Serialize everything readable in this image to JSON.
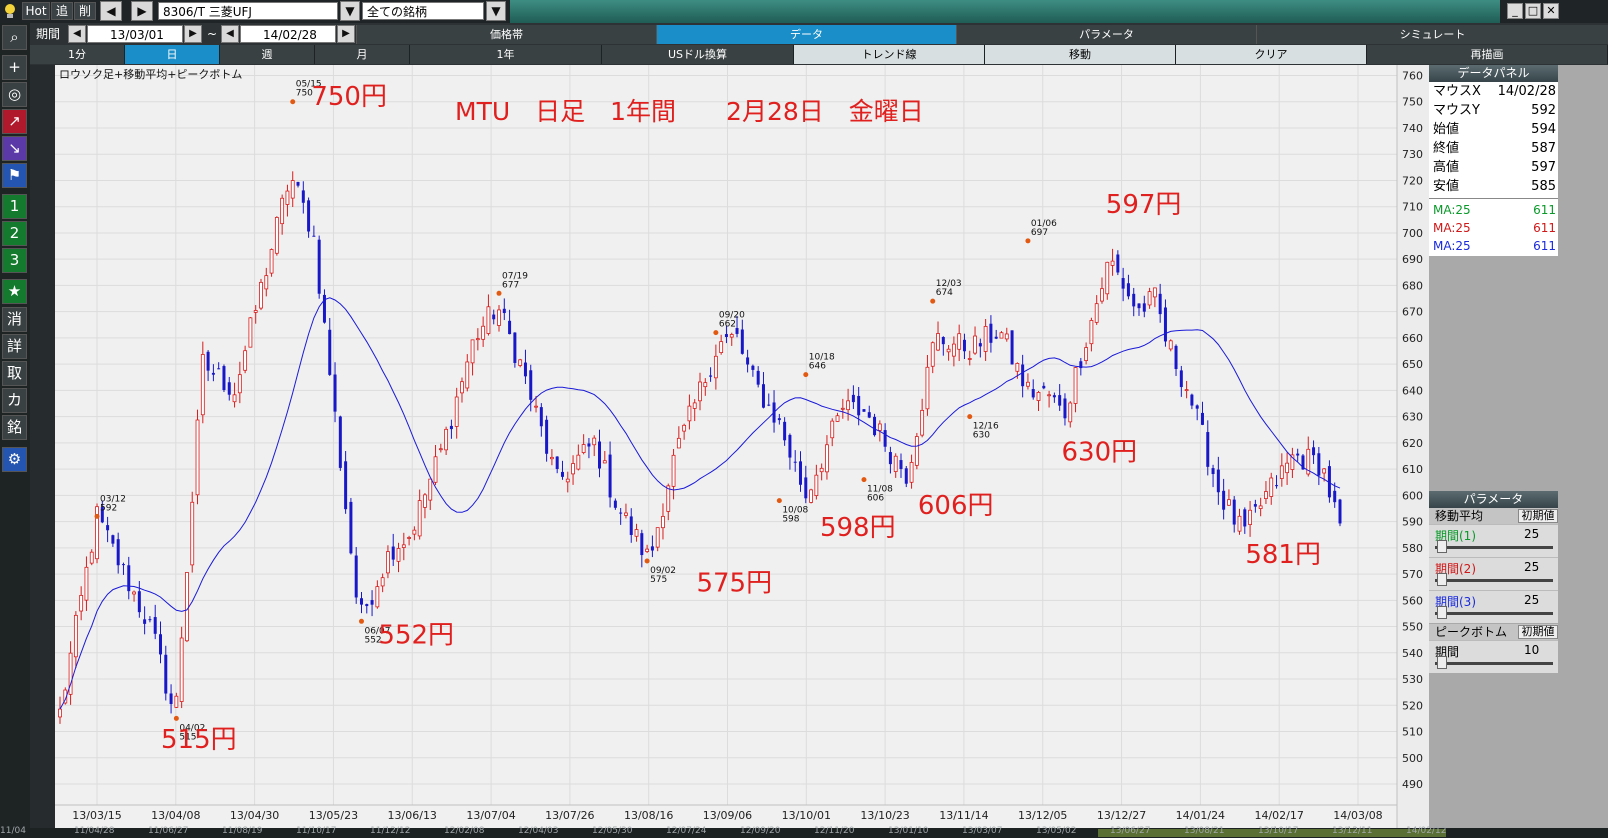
{
  "topbar": {
    "hot": "Hot",
    "tsui": "追",
    "saku": "削",
    "prev_arrow": "◀",
    "next_arrow": "▶",
    "symbol": "8306/T 三菱UFJ",
    "dropdown_arrow": "▼",
    "category": "全ての銘柄",
    "min_btn": "_",
    "max_btn": "□",
    "close_btn": "✕"
  },
  "period_row": {
    "label": "期間",
    "start": "13/03/01",
    "tilde": "~",
    "end": "14/02/28",
    "tabs": [
      "価格帯",
      "データ",
      "パラメータ",
      "シミュレート"
    ]
  },
  "interval_row": {
    "tabs": [
      "1分",
      "日",
      "週",
      "月",
      "1年",
      "USドル換算",
      "トレンド線",
      "移動",
      "クリア",
      "再描画"
    ]
  },
  "sidebar": {
    "buttons": [
      "⌕",
      "+",
      "◎",
      "↗",
      "↘",
      "⚑",
      "1",
      "2",
      "3",
      "★",
      "消",
      "詳",
      "取",
      "カ",
      "銘",
      "⚙"
    ]
  },
  "data_panel": {
    "title": "データパネル",
    "rows": [
      {
        "k": "マウスX",
        "v": "14/02/28"
      },
      {
        "k": "マウスY",
        "v": "592"
      },
      {
        "k": "始値",
        "v": "594"
      },
      {
        "k": "終値",
        "v": "587"
      },
      {
        "k": "高値",
        "v": "597"
      },
      {
        "k": "安値",
        "v": "585"
      }
    ],
    "ma_rows": [
      {
        "k": "MA:25",
        "v": "611",
        "color": "#0a9a2a"
      },
      {
        "k": "MA:25",
        "v": "611",
        "color": "#d01818"
      },
      {
        "k": "MA:25",
        "v": "611",
        "color": "#1a2adc"
      }
    ]
  },
  "param_panel": {
    "title": "パラメータ",
    "ma_header": "移動平均",
    "reset": "初期値",
    "periods": [
      {
        "label": "期間(1)",
        "value": "25",
        "color": "#0a9a2a"
      },
      {
        "label": "期間(2)",
        "value": "25",
        "color": "#d01818"
      },
      {
        "label": "期間(3)",
        "value": "25",
        "color": "#1a2adc"
      }
    ],
    "peak_header": "ピークボトム",
    "peak_reset": "初期値",
    "peak_label": "期間",
    "peak_value": "10"
  },
  "chart_data": {
    "type": "candlestick",
    "legend": "ロウソク足+移動平均+ピークボトム",
    "title": "MTU　日足　1年間　　2月28日　金曜日",
    "ylim": [
      482,
      764
    ],
    "yticks": [
      490,
      500,
      510,
      520,
      530,
      540,
      550,
      560,
      570,
      580,
      590,
      600,
      610,
      620,
      630,
      640,
      650,
      660,
      670,
      680,
      690,
      700,
      710,
      720,
      730,
      740,
      750,
      760
    ],
    "xticks": [
      "13/03/15",
      "13/04/08",
      "13/04/30",
      "13/05/23",
      "13/06/13",
      "13/07/04",
      "13/07/26",
      "13/08/16",
      "13/09/06",
      "13/10/01",
      "13/10/23",
      "13/11/14",
      "13/12/05",
      "13/12/27",
      "14/01/24",
      "14/02/17",
      "14/03/08"
    ],
    "bottom_scroll_dates": [
      "11/04",
      "11/04/28",
      "11/06/27",
      "11/08/19",
      "11/10/17",
      "11/12/12",
      "12/02/08",
      "12/04/03",
      "12/05/30",
      "12/07/24",
      "12/09/20",
      "12/11/20",
      "13/01/10",
      "13/03/07",
      "13/05/02",
      "13/06/27",
      "13/08/21",
      "13/10/17",
      "13/12/11",
      "14/02/12"
    ],
    "ma_period": 25,
    "ma_color": "#1a1ad8",
    "up_color": "#d81c1c",
    "down_color": "#1818c8",
    "days": 243,
    "anchors": [
      [
        0,
        517
      ],
      [
        8,
        592
      ],
      [
        20,
        548
      ],
      [
        25,
        515
      ],
      [
        31,
        650
      ],
      [
        38,
        640
      ],
      [
        50,
        722
      ],
      [
        55,
        700
      ],
      [
        65,
        552
      ],
      [
        72,
        580
      ],
      [
        76,
        585
      ],
      [
        83,
        618
      ],
      [
        90,
        660
      ],
      [
        95,
        672
      ],
      [
        100,
        650
      ],
      [
        108,
        605
      ],
      [
        116,
        620
      ],
      [
        121,
        596
      ],
      [
        128,
        575
      ],
      [
        133,
        612
      ],
      [
        138,
        635
      ],
      [
        143,
        658
      ],
      [
        147,
        660
      ],
      [
        150,
        645
      ],
      [
        156,
        628
      ],
      [
        162,
        600
      ],
      [
        170,
        633
      ],
      [
        175,
        632
      ],
      [
        181,
        615
      ],
      [
        184,
        608
      ],
      [
        190,
        660
      ],
      [
        198,
        656
      ],
      [
        204,
        663
      ],
      [
        210,
        640
      ],
      [
        215,
        638
      ],
      [
        218,
        630
      ],
      [
        222,
        655
      ],
      [
        228,
        690
      ],
      [
        234,
        670
      ],
      [
        238,
        675
      ],
      [
        240,
        660
      ],
      [
        245,
        640
      ],
      [
        252,
        600
      ],
      [
        257,
        585
      ],
      [
        262,
        600
      ],
      [
        268,
        615
      ],
      [
        274,
        612
      ],
      [
        278,
        587
      ]
    ],
    "peaks": [
      {
        "idx": 8,
        "date": "03/12",
        "value": 592,
        "type": "high"
      },
      {
        "idx": 25,
        "date": "04/02",
        "value": 515,
        "type": "low"
      },
      {
        "idx": 50,
        "date": "05/15",
        "value": 750,
        "type": "high"
      },
      {
        "idx": 65,
        "date": "06/07",
        "value": 552,
        "type": "low"
      },
      {
        "idx": 95,
        "date": "07/19",
        "value": 677,
        "type": "high"
      },
      {
        "idx": 128,
        "date": "09/02",
        "value": 575,
        "type": "low"
      },
      {
        "idx": 143,
        "date": "09/20",
        "value": 662,
        "type": "high"
      },
      {
        "idx": 156,
        "date": "10/08",
        "value": 598,
        "type": "low"
      },
      {
        "idx": 162,
        "date": "10/18",
        "value": 646,
        "type": "high"
      },
      {
        "idx": 175,
        "date": "11/08",
        "value": 606,
        "type": "low"
      },
      {
        "idx": 190,
        "date": "12/03",
        "value": 674,
        "type": "high"
      },
      {
        "idx": 198,
        "date": "12/16",
        "value": 630,
        "type": "low"
      },
      {
        "idx": 210,
        "date": "01/06",
        "value": 697,
        "type": "high"
      }
    ],
    "annotations": [
      {
        "text": "750円",
        "x": 0.191,
        "y": 0.024
      },
      {
        "text": "515円",
        "x": 0.079,
        "y": 0.893
      },
      {
        "text": "552円",
        "x": 0.241,
        "y": 0.752
      },
      {
        "text": "575円",
        "x": 0.478,
        "y": 0.682
      },
      {
        "text": "598円",
        "x": 0.57,
        "y": 0.607
      },
      {
        "text": "606円",
        "x": 0.643,
        "y": 0.577
      },
      {
        "text": "630円",
        "x": 0.75,
        "y": 0.505
      },
      {
        "text": "597円",
        "x": 0.783,
        "y": 0.17
      },
      {
        "text": "581円",
        "x": 0.887,
        "y": 0.643
      }
    ]
  }
}
